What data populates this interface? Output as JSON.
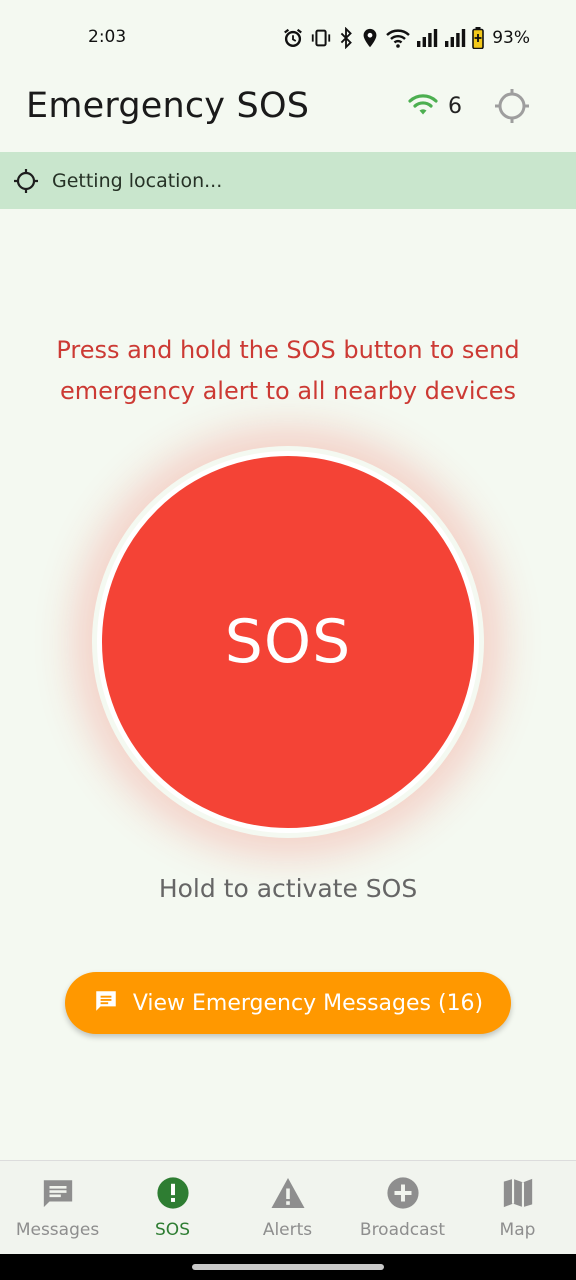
{
  "status_bar": {
    "time": "2:03",
    "battery": "93%",
    "icons": [
      "alarm-icon",
      "vibrate-icon",
      "bluetooth-icon",
      "location-pin-icon",
      "wifi-icon",
      "signal-icon",
      "signal-icon",
      "battery-charging-icon"
    ]
  },
  "app_bar": {
    "title": "Emergency SOS",
    "peer_count": "6",
    "peer_icon": "wifi-icon",
    "location_icon": "crosshair-icon"
  },
  "location_banner": {
    "text": "Getting location...",
    "icon": "crosshair-icon"
  },
  "main": {
    "instructions": "Press and hold the SOS button to send emergency alert to all nearby devices",
    "sos_label": "SOS",
    "hold_hint": "Hold to activate SOS",
    "view_messages_label": "View Emergency Messages (16)"
  },
  "bottom_nav": {
    "items": [
      {
        "label": "Messages",
        "icon": "message-icon",
        "active": false
      },
      {
        "label": "SOS",
        "icon": "alert-circle-icon",
        "active": true
      },
      {
        "label": "Alerts",
        "icon": "warning-icon",
        "active": false
      },
      {
        "label": "Broadcast",
        "icon": "add-circle-icon",
        "active": false
      },
      {
        "label": "Map",
        "icon": "map-icon",
        "active": false
      }
    ]
  },
  "colors": {
    "accent_green": "#2e7d32",
    "sos_red": "#f44336",
    "instruction_red": "#cc3a34",
    "button_orange": "#ff9800",
    "banner_green": "#c9e6cd",
    "background": "#f4f9f1"
  }
}
